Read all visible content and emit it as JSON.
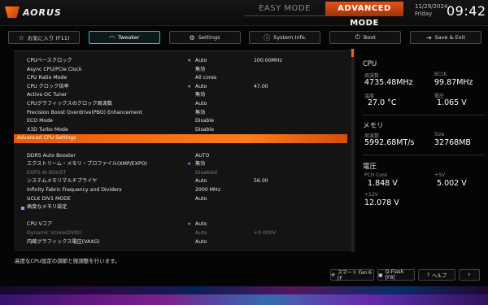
{
  "app": {
    "brand": "AORUS"
  },
  "modes": {
    "easy": "EASY MODE",
    "advanced": "ADVANCED MODE"
  },
  "datetime": {
    "date": "11/29/2024",
    "day": "Friday",
    "time": "09:42"
  },
  "nav": [
    {
      "label": "お気に入り (F11)",
      "icon": "star-icon"
    },
    {
      "label": "Tweaker",
      "icon": "speedometer-icon"
    },
    {
      "label": "Settings",
      "icon": "gear-icon"
    },
    {
      "label": "System Info.",
      "icon": "info-icon"
    },
    {
      "label": "Boot",
      "icon": "power-icon"
    },
    {
      "label": "Save & Exit",
      "icon": "exit-icon"
    }
  ],
  "rows": [
    {
      "label": "CPUベースクロック",
      "star": true,
      "value": "Auto",
      "value2": "100.00MHz"
    },
    {
      "label": "Async CPU/PCIe Clock",
      "star": false,
      "value": "無効",
      "value2": ""
    },
    {
      "label": "CPU Ratio Mode",
      "star": false,
      "value": "All cores",
      "value2": ""
    },
    {
      "label": "CPU クロック倍率",
      "star": true,
      "value": "Auto",
      "value2": "47.00"
    },
    {
      "label": "Active OC Tuner",
      "star": false,
      "value": "無効",
      "value2": ""
    },
    {
      "label": "CPUグラフィックスのクロック周波数",
      "star": false,
      "value": "Auto",
      "value2": ""
    },
    {
      "label": "Precision Boost Overdrive(PBO) Enhancement",
      "star": false,
      "value": "無効",
      "value2": ""
    },
    {
      "label": "ECO Mode",
      "star": false,
      "value": "Disable",
      "value2": ""
    },
    {
      "label": "X3D Turbo Mode",
      "star": false,
      "value": "Disable",
      "value2": ""
    },
    {
      "label": "Advanced CPU Settings",
      "star": false,
      "value": "",
      "value2": "",
      "highlight": true
    },
    {
      "label": "",
      "star": false,
      "value": "",
      "value2": ""
    },
    {
      "label": "DDR5 Auto Booster",
      "star": false,
      "value": "AUTO",
      "value2": ""
    },
    {
      "label": "エクストリーム・メモリ・プロファイル(XMP/EXPO)",
      "star": true,
      "value": "無効",
      "value2": ""
    },
    {
      "label": "EXPO AI BOOST",
      "star": false,
      "value": "Disabled",
      "value2": "",
      "dim": true
    },
    {
      "label": "システムメモリマルチプライヤ",
      "star": false,
      "value": "Auto",
      "value2": "56.00"
    },
    {
      "label": "Infinity Fabric Frequency and Dividers",
      "star": false,
      "value": "2000 MHz",
      "value2": ""
    },
    {
      "label": "UCLK DIV1 MODE",
      "star": false,
      "value": "Auto",
      "value2": ""
    },
    {
      "label": "高度なメモリ設定",
      "star": false,
      "value": "",
      "value2": "",
      "bullet": true
    },
    {
      "label": "",
      "star": false,
      "value": "",
      "value2": ""
    },
    {
      "label": "CPU Vコア",
      "star": true,
      "value": "Auto",
      "value2": ""
    },
    {
      "label": "Dynamic Vcore(DVID)",
      "star": false,
      "value": "Auto",
      "value2": "+0.000V",
      "dim": true
    },
    {
      "label": "内蔵グラフィックス電圧(VAXG)",
      "star": false,
      "value": "Auto",
      "value2": ""
    }
  ],
  "stats": {
    "cpu": {
      "title": "CPU",
      "freq_label": "周波数",
      "freq": "4735.48MHz",
      "bclk_label": "BCLK",
      "bclk": "99.87MHz",
      "temp_label": "温度",
      "temp": "27.0 °C",
      "volt_label": "電圧",
      "volt": "1.065 V"
    },
    "mem": {
      "title": "メモリ",
      "freq_label": "周波数",
      "freq": "5992.68MT/s",
      "size_label": "Size",
      "size": "32768MB"
    },
    "power": {
      "title": "電圧",
      "pch_label": "PCH Core",
      "pch": "1.848 V",
      "v5_label": "+5V",
      "v5": "5.002 V",
      "v12_label": "+12V",
      "v12": "12.078 V"
    }
  },
  "footer": {
    "help_text": "高度なCPU設定の調節と微調整を行います。",
    "smart_fan": "スマート Fan 6 [F",
    "qflash": "Q-Flash [F8]",
    "help": "ヘルプ"
  },
  "colors": {
    "accent": "#e8661b",
    "active_tab": "#27c3c9"
  }
}
